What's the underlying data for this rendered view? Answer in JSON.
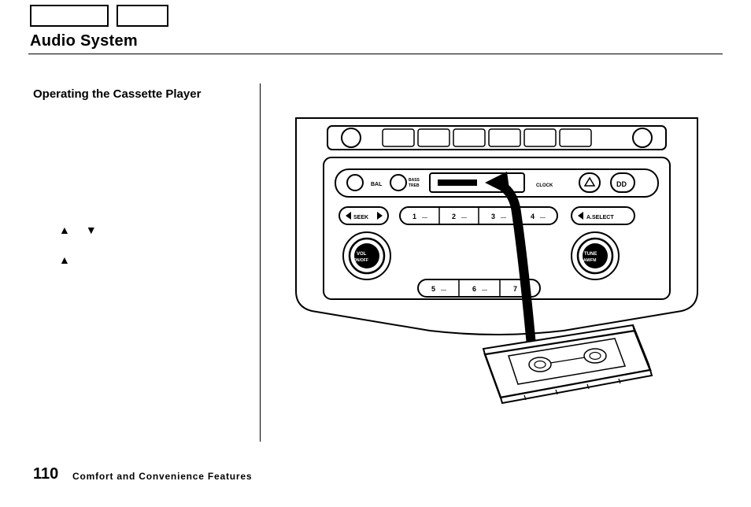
{
  "header": {
    "page_title": "Audio System"
  },
  "section": {
    "subtitle": "Operating the Cassette Player"
  },
  "triangles": {
    "up": "▲",
    "down": "▼"
  },
  "footer": {
    "page_number": "110",
    "section_label": "Comfort and Convenience Features"
  },
  "illustration": {
    "buttons": {
      "bal": "BAL",
      "bass_treb": "BASS\nTREB",
      "clock": "CLOCK",
      "seek": "SEEK",
      "aselect": "A.SELECT",
      "vol": "VOL\nON/OFF",
      "tune": "TUNE\nAM/FM",
      "preset1": "1",
      "preset2": "2",
      "preset3": "3",
      "preset4": "4",
      "preset5": "5",
      "preset6": "6",
      "preset7": "7"
    }
  }
}
